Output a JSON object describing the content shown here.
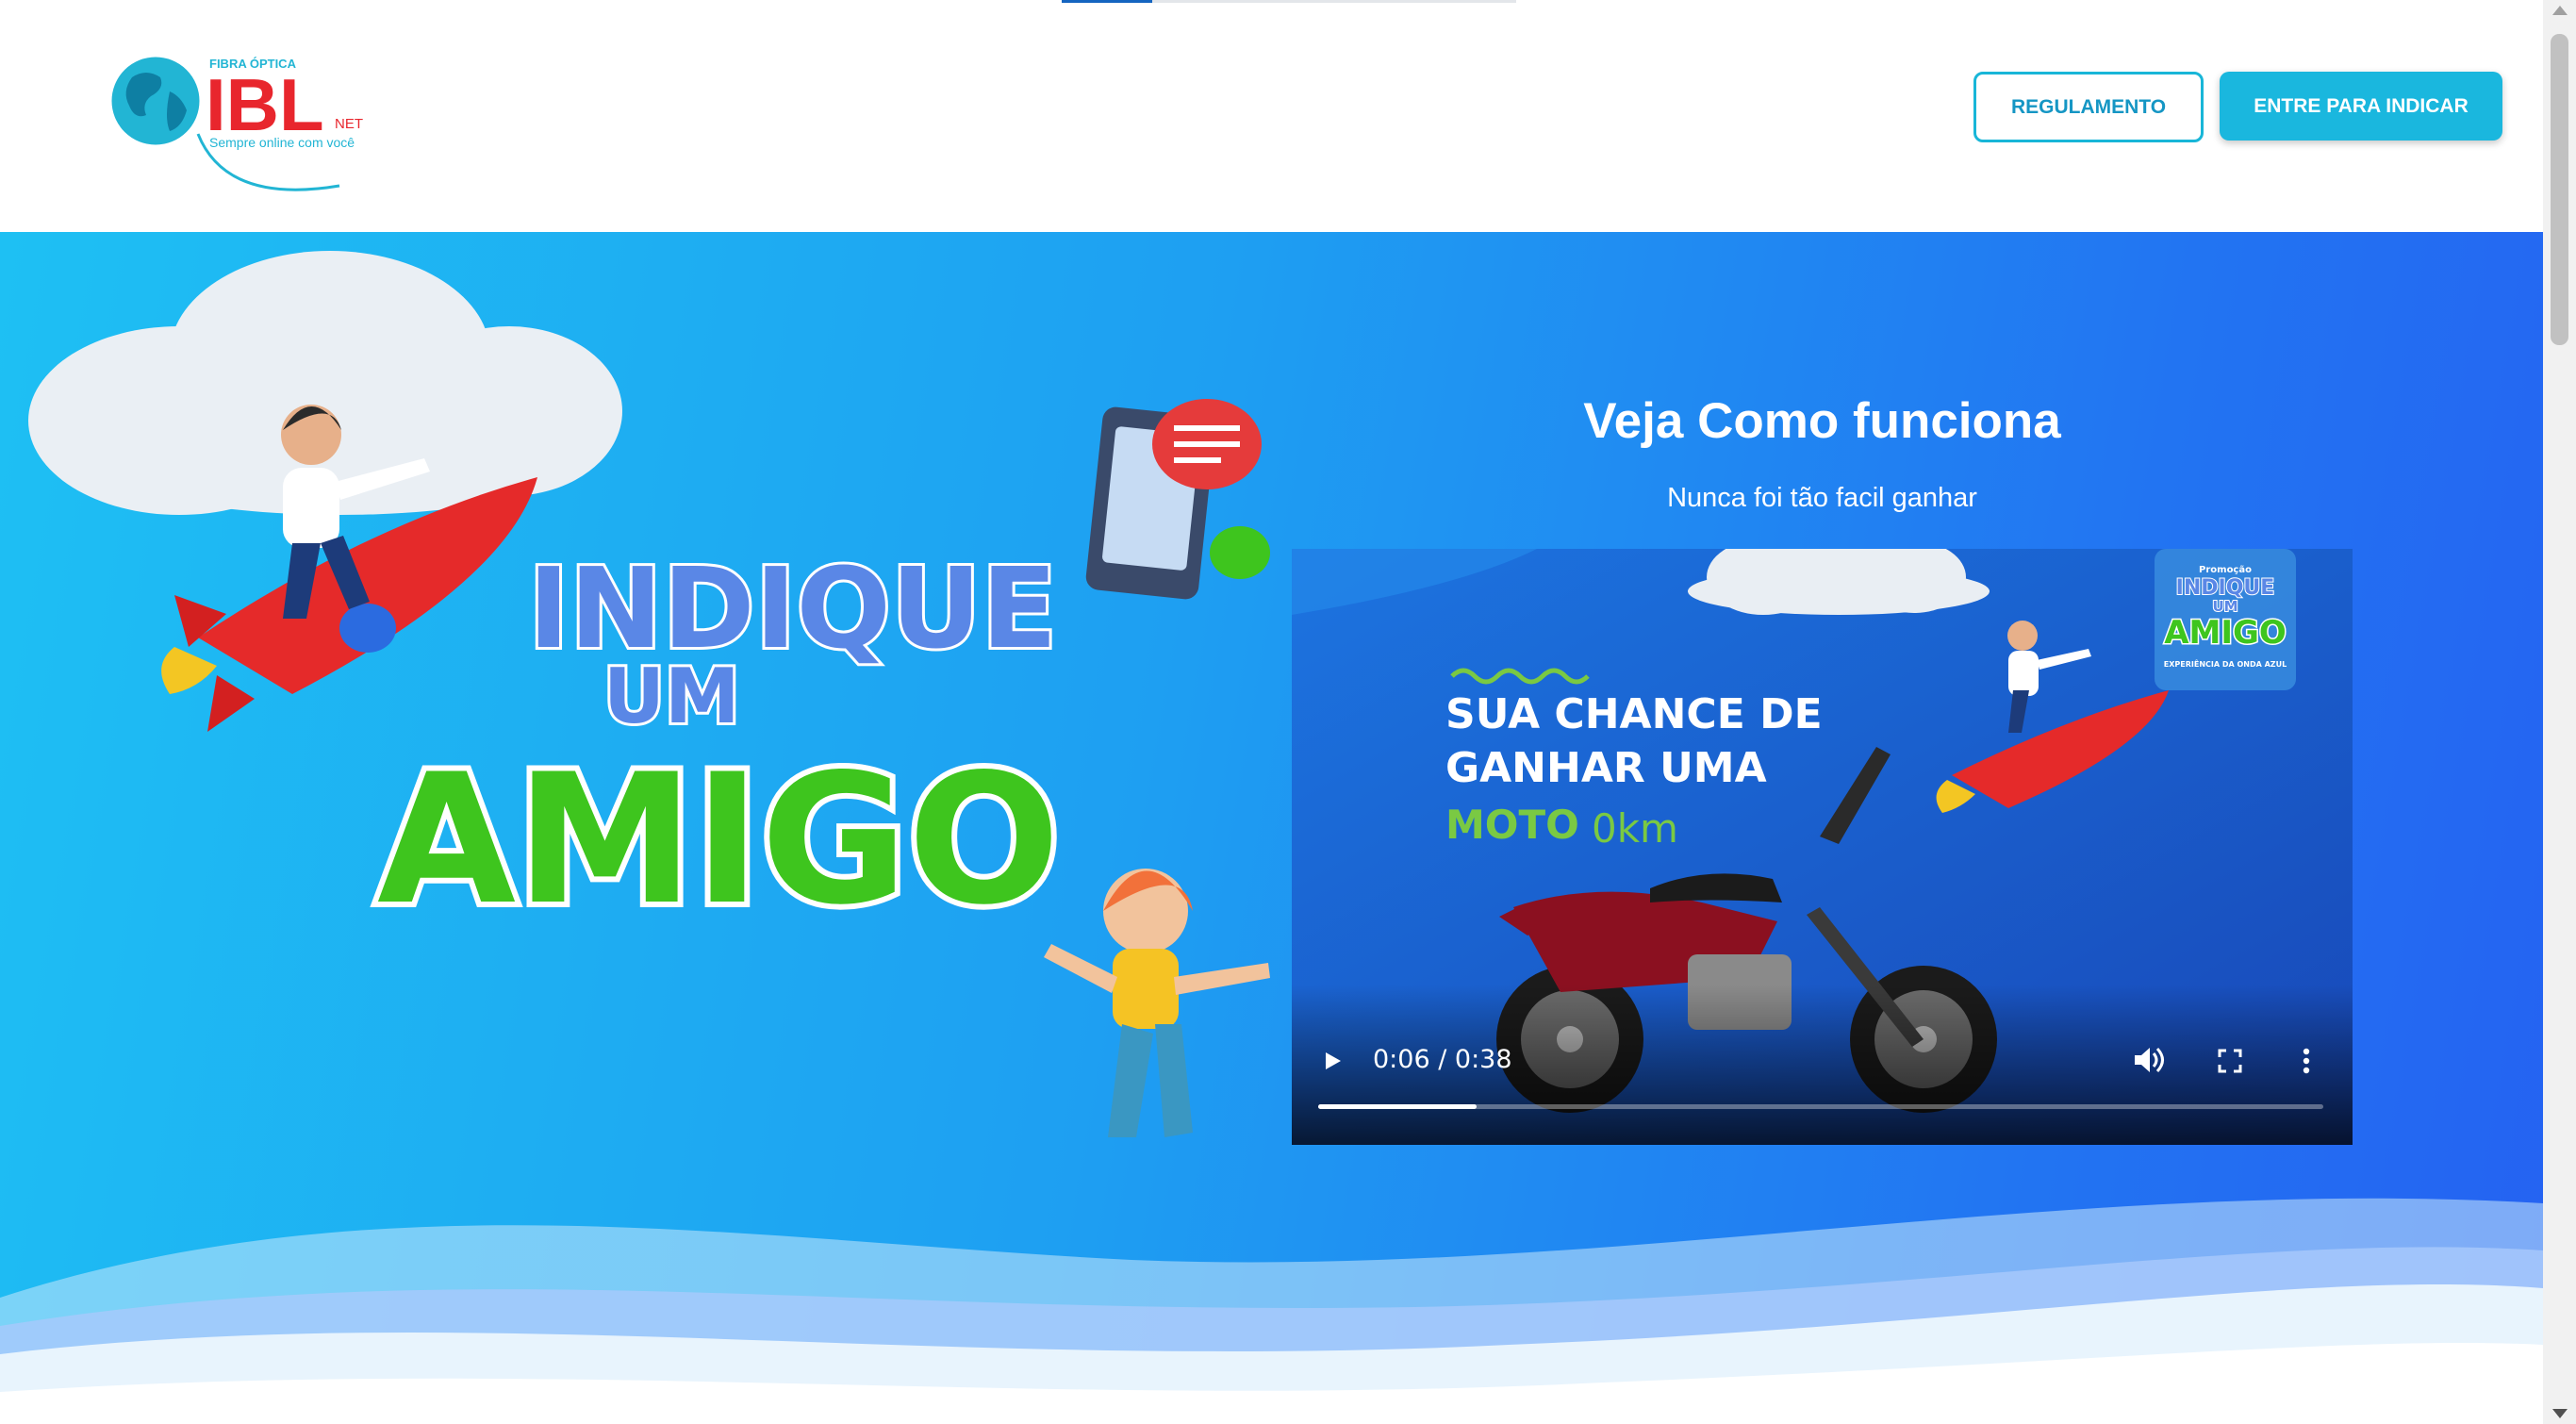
{
  "header": {
    "logo": {
      "brand": "IBL",
      "tagline_top": "FIBRA ÓPTICA",
      "suffix": "NET",
      "slogan": "Sempre online com você"
    },
    "buttons": {
      "regulamento": "REGULAMENTO",
      "entre": "ENTRE PARA INDICAR"
    }
  },
  "hero": {
    "campaign_art": {
      "line1": "INDIQUE",
      "line2": "UM",
      "line3": "AMIGO"
    },
    "title": "Veja Como funciona",
    "subtitle": "Nunca foi tão facil ganhar"
  },
  "video": {
    "frame_text": {
      "line1": "SUA CHANCE DE",
      "line2": "GANHAR UMA",
      "moto": "MOTO",
      "km": "0km",
      "badge_top": "Promoção",
      "badge_line1": "INDIQUE",
      "badge_line2": "UM",
      "badge_line3": "AMIGO",
      "badge_bottom": "EXPERIÊNCIA DA ONDA AZUL"
    },
    "time_display": "0:06 / 0:38",
    "progress": 0.158,
    "icons": {
      "play": "play-icon",
      "volume": "volume-icon",
      "fullscreen": "fullscreen-icon",
      "more": "more-vert-icon"
    }
  },
  "colors": {
    "accent": "#1ab7de",
    "hero_start": "#1ec0f3",
    "hero_end": "#2562f2",
    "amigo_green": "#3ec51e",
    "rocket_red": "#e52a2a"
  }
}
